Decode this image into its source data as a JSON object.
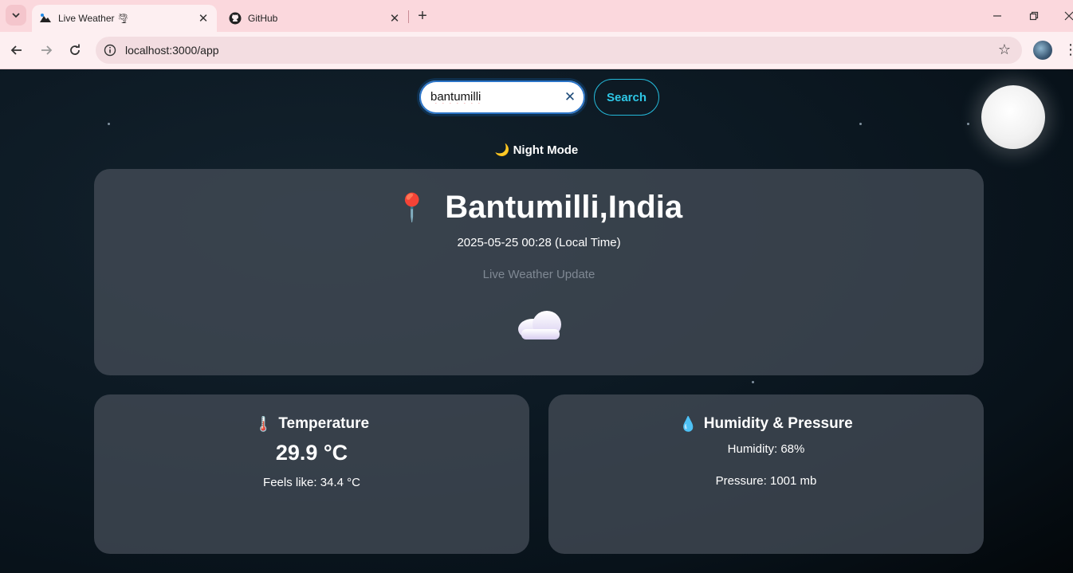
{
  "browser": {
    "tabs": [
      {
        "title": "Live Weather 🌪",
        "active": true
      },
      {
        "title": "GitHub",
        "active": false
      }
    ],
    "url": "localhost:3000/app"
  },
  "search": {
    "value": "bantumilli",
    "button_label": "Search"
  },
  "mode_label": "🌙 Night Mode",
  "location": {
    "pin": "📍",
    "name": "Bantumilli,India",
    "local_time": "2025-05-25 00:28 (Local Time)",
    "subtitle": "Live Weather Update",
    "condition_icon": "cloud-icon"
  },
  "temperature": {
    "icon": "🌡️",
    "title": "Temperature",
    "value": "29.9 °C",
    "feels_like": "Feels like: 34.4 °C"
  },
  "humidity_pressure": {
    "icon": "💧",
    "title": "Humidity & Pressure",
    "humidity": "Humidity: 68%",
    "pressure": "Pressure: 1001 mb"
  },
  "colors": {
    "accent": "#2ec7e6",
    "background": "#0b1620",
    "card": "#464e58"
  }
}
